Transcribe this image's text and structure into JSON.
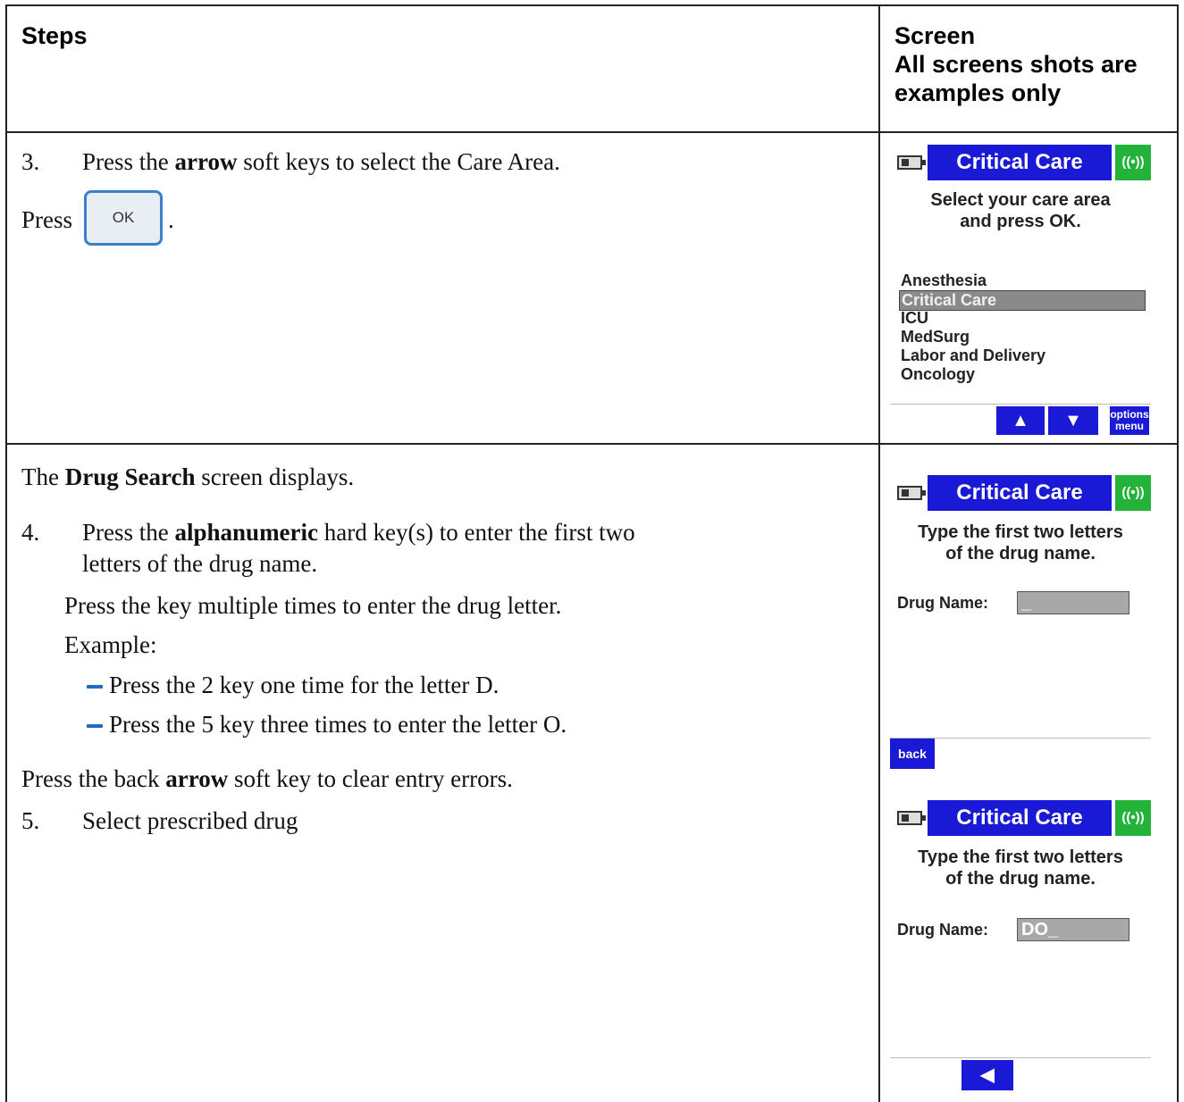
{
  "header": {
    "steps": "Steps",
    "screen_line1": "Screen",
    "screen_line2": "All screens shots are",
    "screen_line3": "examples only"
  },
  "row1": {
    "step_num": "3.",
    "step_pre": "Press the ",
    "step_bold": "arrow",
    "step_post": " soft keys to select the Care Area.",
    "press_label": "Press",
    "ok_key": "OK",
    "press_end": "."
  },
  "row2": {
    "intro_pre": "The ",
    "intro_bold": "Drug Search",
    "intro_post": " screen displays.",
    "step4_num": "4.",
    "step4_pre": "Press the ",
    "step4_bold": "alphanumeric",
    "step4_post": " hard key(s) to enter the first two",
    "step4_line2": "letters of the drug name.",
    "multi": "Press the key multiple times to enter the drug letter.",
    "example": "Example:",
    "bullet1": "Press the 2 key one time for the letter D.",
    "bullet2": "Press the 5 key three times to enter the letter O.",
    "back_pre": "Press the back ",
    "back_bold": "arrow",
    "back_post": " soft key to clear entry errors.",
    "step5_num": "5.",
    "step5_text": "Select prescribed drug"
  },
  "screen1": {
    "title": "Critical Care",
    "wifi_glyph": "((•))",
    "msg_line1": "Select your care area",
    "msg_line2": "and press OK.",
    "items": [
      "Anesthesia",
      "Critical Care",
      "ICU",
      "MedSurg",
      "Labor and Delivery",
      "Oncology"
    ],
    "selected_index": 1,
    "up_key": "▲",
    "down_key": "▼",
    "options_line1": "options",
    "options_line2": "menu"
  },
  "screen2": {
    "title": "Critical Care",
    "wifi_glyph": "((•))",
    "msg_line1": "Type the first two letters",
    "msg_line2": "of the drug name.",
    "field_label": "Drug Name:",
    "field_value": "_",
    "back_key": "back"
  },
  "screen3": {
    "title": "Critical Care",
    "wifi_glyph": "((•))",
    "msg_line1": "Type the first two letters",
    "msg_line2": "of the drug name.",
    "field_label": "Drug Name:",
    "field_value": "DO_",
    "back_arrow": "◀"
  },
  "colors": {
    "title_blue": "#1a1ad6",
    "wifi_green": "#23b23a",
    "bullet_blue": "#1a6fc4"
  }
}
